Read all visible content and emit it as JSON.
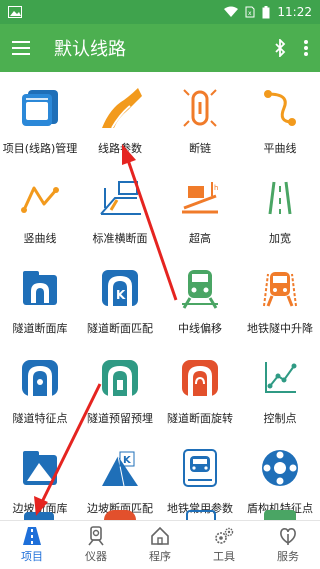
{
  "status": {
    "time": "11:22"
  },
  "appbar": {
    "title": "默认线路"
  },
  "grid": {
    "items": [
      {
        "label": "项目(线路)管理",
        "icon": "project-manage-icon"
      },
      {
        "label": "线路参数",
        "icon": "route-params-icon"
      },
      {
        "label": "断链",
        "icon": "chain-break-icon"
      },
      {
        "label": "平曲线",
        "icon": "horizontal-curve-icon"
      },
      {
        "label": "竖曲线",
        "icon": "vertical-curve-icon"
      },
      {
        "label": "标准横断面",
        "icon": "standard-cross-section-icon"
      },
      {
        "label": "超高",
        "icon": "superelevation-icon"
      },
      {
        "label": "加宽",
        "icon": "widening-icon"
      },
      {
        "label": "隧道断面库",
        "icon": "tunnel-section-library-icon"
      },
      {
        "label": "隧道断面匹配",
        "icon": "tunnel-section-match-icon"
      },
      {
        "label": "中线偏移",
        "icon": "centerline-offset-icon"
      },
      {
        "label": "地铁隧中升降",
        "icon": "metro-tunnel-lift-icon"
      },
      {
        "label": "隧道特征点",
        "icon": "tunnel-feature-point-icon"
      },
      {
        "label": "隧道预留预埋",
        "icon": "tunnel-embedded-icon"
      },
      {
        "label": "隧道断面旋转",
        "icon": "tunnel-section-rotate-icon"
      },
      {
        "label": "控制点",
        "icon": "control-point-icon"
      },
      {
        "label": "边坡断面库",
        "icon": "slope-section-library-icon"
      },
      {
        "label": "边坡断面匹配",
        "icon": "slope-section-match-icon"
      },
      {
        "label": "地铁常用参数",
        "icon": "metro-params-icon"
      },
      {
        "label": "盾构机特征点",
        "icon": "shield-machine-icon"
      }
    ]
  },
  "nav": {
    "tabs": [
      {
        "label": "项目",
        "icon": "road-icon",
        "active": true
      },
      {
        "label": "仪器",
        "icon": "instrument-icon",
        "active": false
      },
      {
        "label": "程序",
        "icon": "home-icon",
        "active": false
      },
      {
        "label": "工具",
        "icon": "gears-icon",
        "active": false
      },
      {
        "label": "服务",
        "icon": "service-icon",
        "active": false
      }
    ]
  },
  "colors": {
    "primary": "#4caf50",
    "statusbar": "#3fa34d",
    "active_tab": "#1e6fd9",
    "annotation_arrow": "#e52420"
  }
}
